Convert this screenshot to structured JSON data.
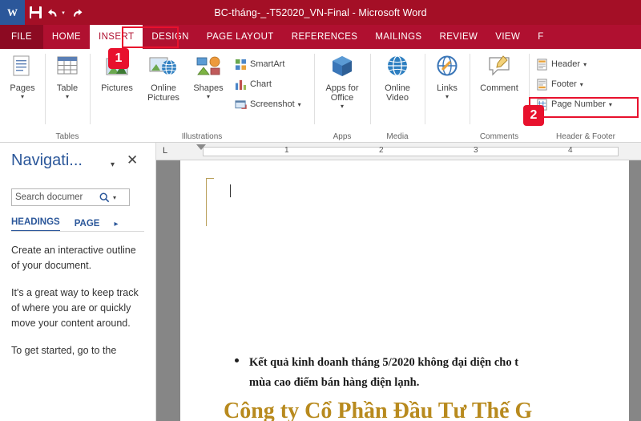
{
  "titlebar": {
    "app_icon": "word-logo-icon",
    "logo_letter": "W",
    "title": "BC-tháng-_-T52020_VN-Final  -  Microsoft Word",
    "quick_access": [
      {
        "name": "save-button",
        "icon": "save-icon",
        "label": ""
      },
      {
        "name": "undo-button",
        "icon": "undo-icon",
        "label": "↰"
      },
      {
        "name": "redo-button",
        "icon": "redo-icon",
        "label": "↻"
      }
    ]
  },
  "tabs": [
    {
      "key": "file",
      "label": "FILE"
    },
    {
      "key": "home",
      "label": "HOME"
    },
    {
      "key": "insert",
      "label": "INSERT"
    },
    {
      "key": "design",
      "label": "DESIGN"
    },
    {
      "key": "page_layout",
      "label": "PAGE LAYOUT"
    },
    {
      "key": "references",
      "label": "REFERENCES"
    },
    {
      "key": "mailings",
      "label": "MAILINGS"
    },
    {
      "key": "review",
      "label": "REVIEW"
    },
    {
      "key": "view",
      "label": "VIEW"
    },
    {
      "key": "foxit",
      "label": "F"
    }
  ],
  "active_tab": "INSERT",
  "callouts": [
    {
      "number": "1",
      "target": "insert-tab"
    },
    {
      "number": "2",
      "target": "page-number-button"
    }
  ],
  "ribbon": {
    "groups": [
      {
        "name": "pages",
        "label": "",
        "buttons": [
          {
            "name": "pages-button",
            "label": "Pages",
            "icon": "pages-icon",
            "has_caret": true
          }
        ]
      },
      {
        "name": "tables",
        "label": "Tables",
        "buttons": [
          {
            "name": "table-button",
            "label": "Table",
            "icon": "table-icon",
            "has_caret": true
          }
        ]
      },
      {
        "name": "illustrations",
        "label": "Illustrations",
        "buttons": [
          {
            "name": "pictures-button",
            "label": "Pictures",
            "icon": "pictures-icon",
            "has_caret": false
          },
          {
            "name": "online-pictures-button",
            "label": "Online\nPictures",
            "label_line1": "Online",
            "label_line2": "Pictures",
            "icon": "online-pictures-icon",
            "has_caret": false
          },
          {
            "name": "shapes-button",
            "label": "Shapes",
            "icon": "shapes-icon",
            "has_caret": true
          },
          {
            "name": "smartart-button",
            "label": "SmartArt",
            "icon": "smartart-icon"
          },
          {
            "name": "chart-button",
            "label": "Chart",
            "icon": "chart-icon"
          },
          {
            "name": "screenshot-button",
            "label": "Screenshot",
            "icon": "screenshot-icon",
            "has_caret": true
          }
        ]
      },
      {
        "name": "apps",
        "label": "Apps",
        "buttons": [
          {
            "name": "apps-for-office-button",
            "label_line1": "Apps for",
            "label_line2": "Office",
            "icon": "apps-icon",
            "has_caret": true
          }
        ]
      },
      {
        "name": "media",
        "label": "Media",
        "buttons": [
          {
            "name": "online-video-button",
            "label_line1": "Online",
            "label_line2": "Video",
            "icon": "online-video-icon",
            "has_caret": false
          }
        ]
      },
      {
        "name": "links",
        "label": "",
        "buttons": [
          {
            "name": "links-button",
            "label": "Links",
            "icon": "links-icon",
            "has_caret": true
          }
        ]
      },
      {
        "name": "comments",
        "label": "Comments",
        "buttons": [
          {
            "name": "comment-button",
            "label": "Comment",
            "icon": "comment-icon",
            "has_caret": false
          }
        ]
      },
      {
        "name": "header_footer",
        "label": "Header & Footer",
        "buttons": [
          {
            "name": "header-button",
            "label": "Header",
            "icon": "header-icon",
            "has_caret": true
          },
          {
            "name": "footer-button",
            "label": "Footer",
            "icon": "footer-icon",
            "has_caret": true
          },
          {
            "name": "page-number-button",
            "label": "Page Number",
            "icon": "page-number-icon",
            "has_caret": true
          }
        ]
      }
    ]
  },
  "navigation_pane": {
    "title": "Navigati...",
    "dropdown_icon": "chevron-down-icon",
    "close_icon": "close-icon",
    "search": {
      "value": "Search documer",
      "placeholder": "Search document",
      "icon": "search-icon",
      "caret_icon": "chevron-down-icon"
    },
    "tabs": [
      {
        "key": "headings",
        "label": "HEADINGS",
        "active": true
      },
      {
        "key": "pages",
        "label": "PAGE",
        "active": false
      }
    ],
    "tab_overflow_icon": "chevron-right-icon",
    "body_paragraphs": [
      "Create an interactive outline of your document.",
      "It's a great way to keep track of where you are or quickly move your content around.",
      "To get started, go to the"
    ]
  },
  "ruler": {
    "corner_label": "L",
    "numbers": [
      "1",
      "2",
      "3",
      "4"
    ]
  },
  "document": {
    "bullet_text_line1": "Kết quả kinh doanh tháng 5/2020 không đại diện cho t",
    "bullet_text_line2": "mùa cao điểm bán hàng điện lạnh.",
    "heading": "Công ty Cổ Phần Đầu Tư Thế G"
  },
  "colors": {
    "titlebar": "#a40f26",
    "ribbon_tabs": "#b01030",
    "file_tab": "#8c0a22",
    "accent_blue": "#2b579a",
    "callout_red": "#e8112d",
    "heading_gold": "#b88a1e",
    "doc_background": "#868686"
  }
}
